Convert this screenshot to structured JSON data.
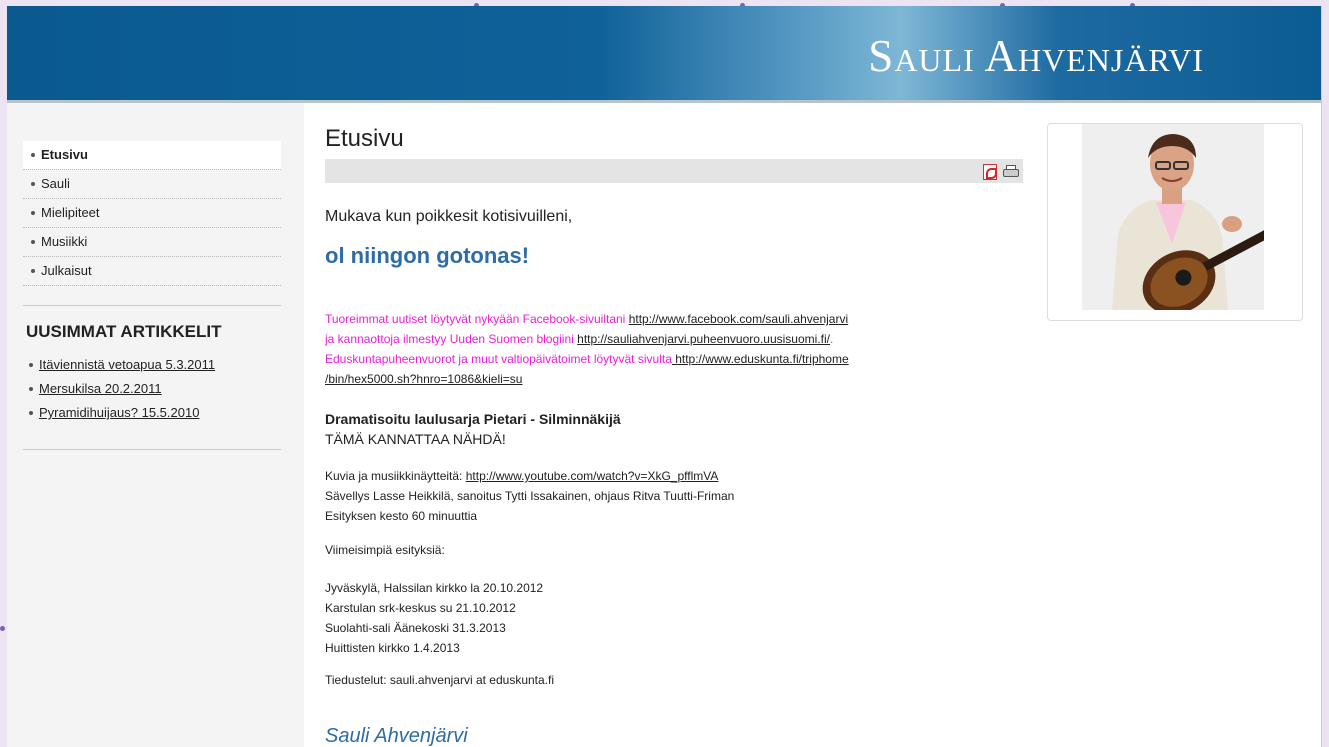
{
  "header": {
    "site_title": "Sauli Ahvenjärvi"
  },
  "sidebar": {
    "nav": [
      {
        "label": "Etusivu"
      },
      {
        "label": "Sauli"
      },
      {
        "label": "Mielipiteet"
      },
      {
        "label": "Musiikki"
      },
      {
        "label": "Julkaisut"
      }
    ],
    "articles_heading": "UUSIMMAT ARTIKKELIT",
    "articles": [
      {
        "label": "Itäviennistä vetoapua 5.3.2011"
      },
      {
        "label": "Mersukilsa 20.2.2011"
      },
      {
        "label": "Pyramidihuijaus? 15.5.2010"
      }
    ]
  },
  "main": {
    "title": "Etusivu",
    "intro": "Mukava kun poikkesit kotisivuilleni,",
    "slogan": "ol niingon gotonas!",
    "news": {
      "line1_text": "Tuoreimmat uutiset löytyvät nykyään Facebook-sivuiltani ",
      "line1_link": "http://www.facebook.com/sauli.ahvenjarvi",
      "line2_text": "ja kannaottoja ilmestyy Uuden Suomen blogiini ",
      "line2_link": "http://sauliahvenjarvi.puheenvuoro.uusisuomi.fi/",
      "line2_end": ".",
      "line3_text": "Eduskuntapuheenvuorot ja muut valtiopäivätoimet löytyvät sivulta",
      "line3_link": " http://www.eduskunta.fi/triphome",
      "line4_link": "/bin/hex5000.sh?hnro=1086&kieli=su"
    },
    "drama_title": "Dramatisoitu laulusarja Pietari - Silminnäkijä",
    "drama_sub": "TÄMÄ KANNATTAA NÄHDÄ!",
    "info": {
      "video_label": "Kuvia ja musiikkinäytteitä: ",
      "video_link": "http://www.youtube.com/watch?v=XkG_pfflmVA",
      "credits": "Sävellys Lasse Heikkilä, sanoitus Tytti Issakainen, ohjaus Ritva Tuutti-Friman",
      "duration": "Esityksen kesto 60 minuuttia"
    },
    "recent_heading": "Viimeisimpiä esityksiä:",
    "performances": [
      "Jyväskylä, Halssilan kirkko la 20.10.2012",
      "Karstulan srk-keskus su 21.10.2012",
      "Suolahti-sali Äänekoski 31.3.2013",
      "Huittisten kirkko 1.4.2013"
    ],
    "contact": "Tiedustelut: sauli.ahvenjarvi at eduskunta.fi",
    "signature": "Sauli Ahvenjärvi"
  },
  "icons": [
    "pdf-icon",
    "print-icon"
  ],
  "colors": {
    "header_blue": "#0f6199",
    "pink_text": "#e81fd6",
    "slogan_blue": "#2e6ca8"
  }
}
